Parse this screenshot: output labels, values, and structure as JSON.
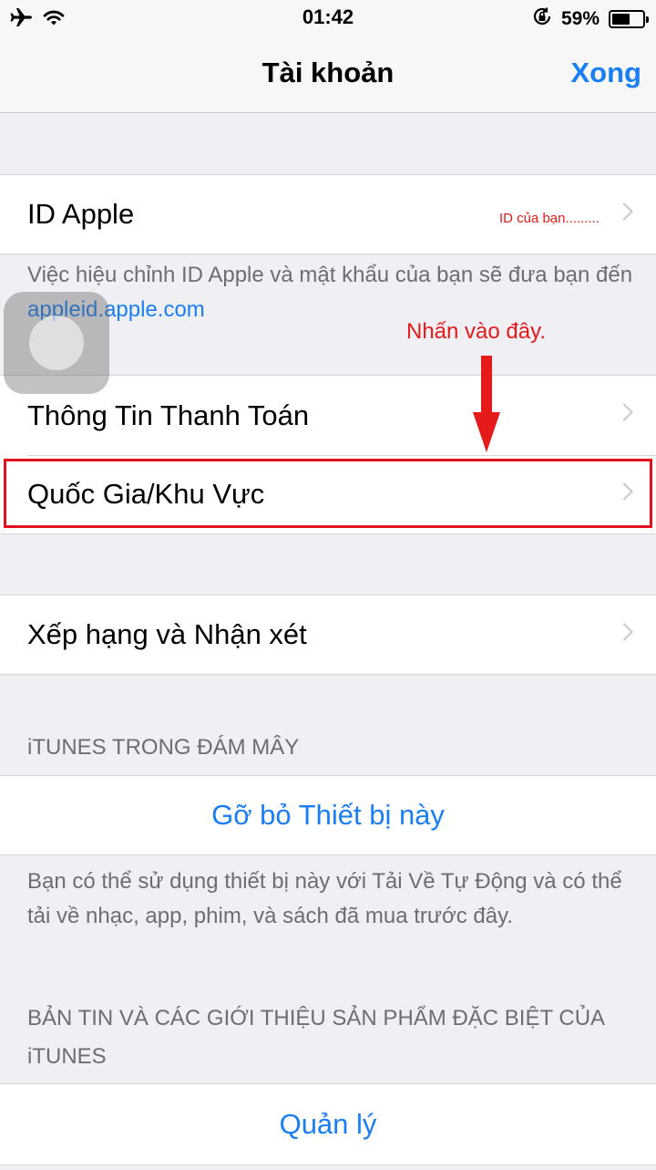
{
  "status": {
    "time": "01:42",
    "battery_percent_label": "59%",
    "battery_level": 0.59
  },
  "nav": {
    "title": "Tài khoản",
    "done_label": "Xong"
  },
  "account": {
    "apple_id_label": "ID Apple",
    "apple_id_value": "ID của bạn.........",
    "apple_id_footer": "Việc hiệu chỉnh ID Apple và mật khẩu của bạn sẽ đưa bạn đến",
    "apple_id_link": "appleid.apple.com",
    "payment_info_label": "Thông Tin Thanh Toán",
    "country_region_label": "Quốc Gia/Khu Vực"
  },
  "annotation": {
    "tap_here": "Nhấn vào đây.",
    "color": "#e51a1a"
  },
  "ratings": {
    "label": "Xếp hạng và Nhận xét"
  },
  "itunes_cloud": {
    "header": "iTUNES TRONG ĐÁM MÂY",
    "remove_device_label": "Gỡ bỏ Thiết bị này",
    "footer": "Bạn có thể sử dụng thiết bị này với Tải Về Tự Động và có thể tải về nhạc, app, phim, và sách đã mua trước đây."
  },
  "newsletter": {
    "header": "BẢN TIN VÀ CÁC GIỚI THIỆU SẢN PHẨM ĐẶC BIỆT CỦA iTUNES",
    "manage_label": "Quản lý"
  },
  "icons": {
    "airplane": "airplane-icon",
    "wifi": "wifi-icon",
    "rotation_lock": "rotation-lock-icon",
    "battery": "battery-icon",
    "chevron": "chevron-right-icon"
  },
  "colors": {
    "accent": "#1a7ef5",
    "background": "#efeff4",
    "secondary_text": "#6d6d72"
  }
}
